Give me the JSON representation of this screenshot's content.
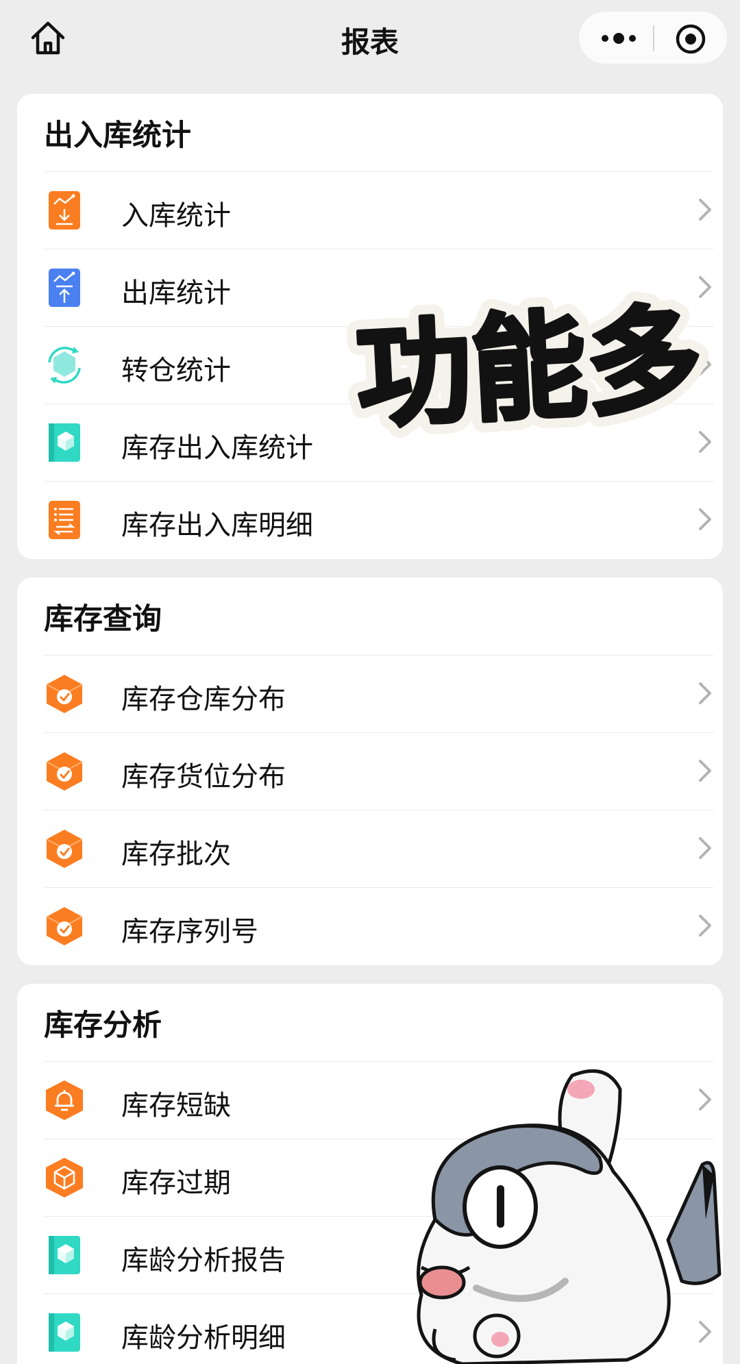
{
  "header": {
    "title": "报表",
    "home_icon": "home-icon",
    "more_icon": "more-dots-icon",
    "target_icon": "record-target-icon"
  },
  "sections": [
    {
      "title": "出入库统计",
      "items": [
        {
          "label": "入库统计",
          "icon": "inbound-chart-icon"
        },
        {
          "label": "出库统计",
          "icon": "outbound-chart-icon"
        },
        {
          "label": "转仓统计",
          "icon": "transfer-cycle-icon"
        },
        {
          "label": "库存出入库统计",
          "icon": "inventory-book-icon"
        },
        {
          "label": "库存出入库明细",
          "icon": "detail-list-icon"
        }
      ]
    },
    {
      "title": "库存查询",
      "items": [
        {
          "label": "库存仓库分布",
          "icon": "hex-check-icon"
        },
        {
          "label": "库存货位分布",
          "icon": "hex-check-icon"
        },
        {
          "label": "库存批次",
          "icon": "hex-check-icon"
        },
        {
          "label": "库存序列号",
          "icon": "hex-check-icon"
        }
      ]
    },
    {
      "title": "库存分析",
      "items": [
        {
          "label": "库存短缺",
          "icon": "bell-alert-icon"
        },
        {
          "label": "库存过期",
          "icon": "box-hex-icon"
        },
        {
          "label": "库龄分析报告",
          "icon": "inventory-book-icon"
        },
        {
          "label": "库龄分析明细",
          "icon": "inventory-book-icon"
        }
      ]
    }
  ],
  "overlay": {
    "sticker_text": "功能多",
    "mascot": "shark-cat-mascot"
  },
  "colors": {
    "background": "#ededed",
    "card": "#ffffff",
    "orange": "#fb7d21",
    "blue": "#4a80f0",
    "teal": "#2fd9c4",
    "chevron": "#b3b3b3"
  }
}
